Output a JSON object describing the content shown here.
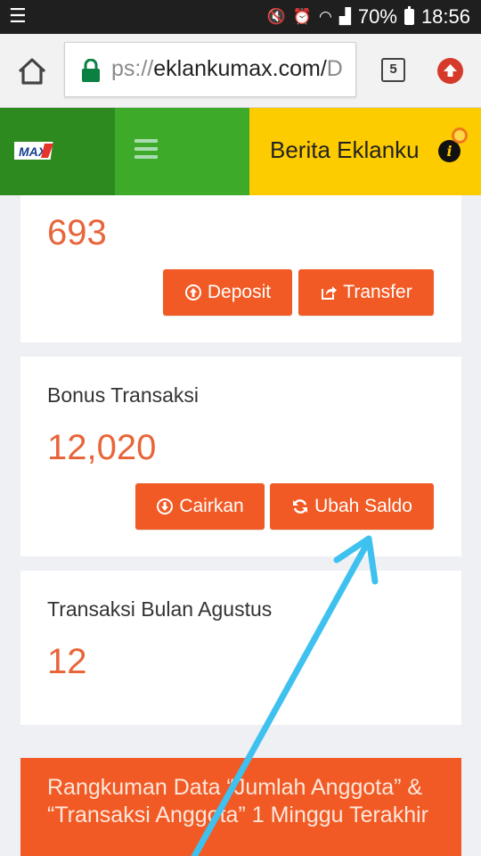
{
  "status_bar": {
    "battery": "70%",
    "time": "18:56"
  },
  "browser": {
    "url_dim": "ps://",
    "url_main": "eklankumax.com/",
    "url_tail": "D",
    "tab_count": "5"
  },
  "header": {
    "logo_text": "MAX",
    "news_label": "Berita Eklanku"
  },
  "cards": [
    {
      "title": "",
      "value": "693",
      "buttons": [
        {
          "label": "Deposit",
          "icon": "arrow-circle-up-icon"
        },
        {
          "label": "Transfer",
          "icon": "share-icon"
        }
      ]
    },
    {
      "title": "Bonus Transaksi",
      "value": "12,020",
      "buttons": [
        {
          "label": "Cairkan",
          "icon": "arrow-circle-down-icon"
        },
        {
          "label": "Ubah Saldo",
          "icon": "refresh-icon"
        }
      ]
    },
    {
      "title": "Transaksi Bulan Agustus",
      "value": "12"
    }
  ],
  "summary": {
    "text": "Rangkuman Data “Jumlah Anggota” & “Transaksi Anggota” 1 Minggu Terakhir"
  },
  "colors": {
    "accent": "#f15a24",
    "value_text": "#e8653a",
    "header_dark_green": "#2d8a1e",
    "header_green": "#3daa2a",
    "header_yellow": "#fdcc00",
    "annotation_arrow": "#3ec1ef"
  }
}
